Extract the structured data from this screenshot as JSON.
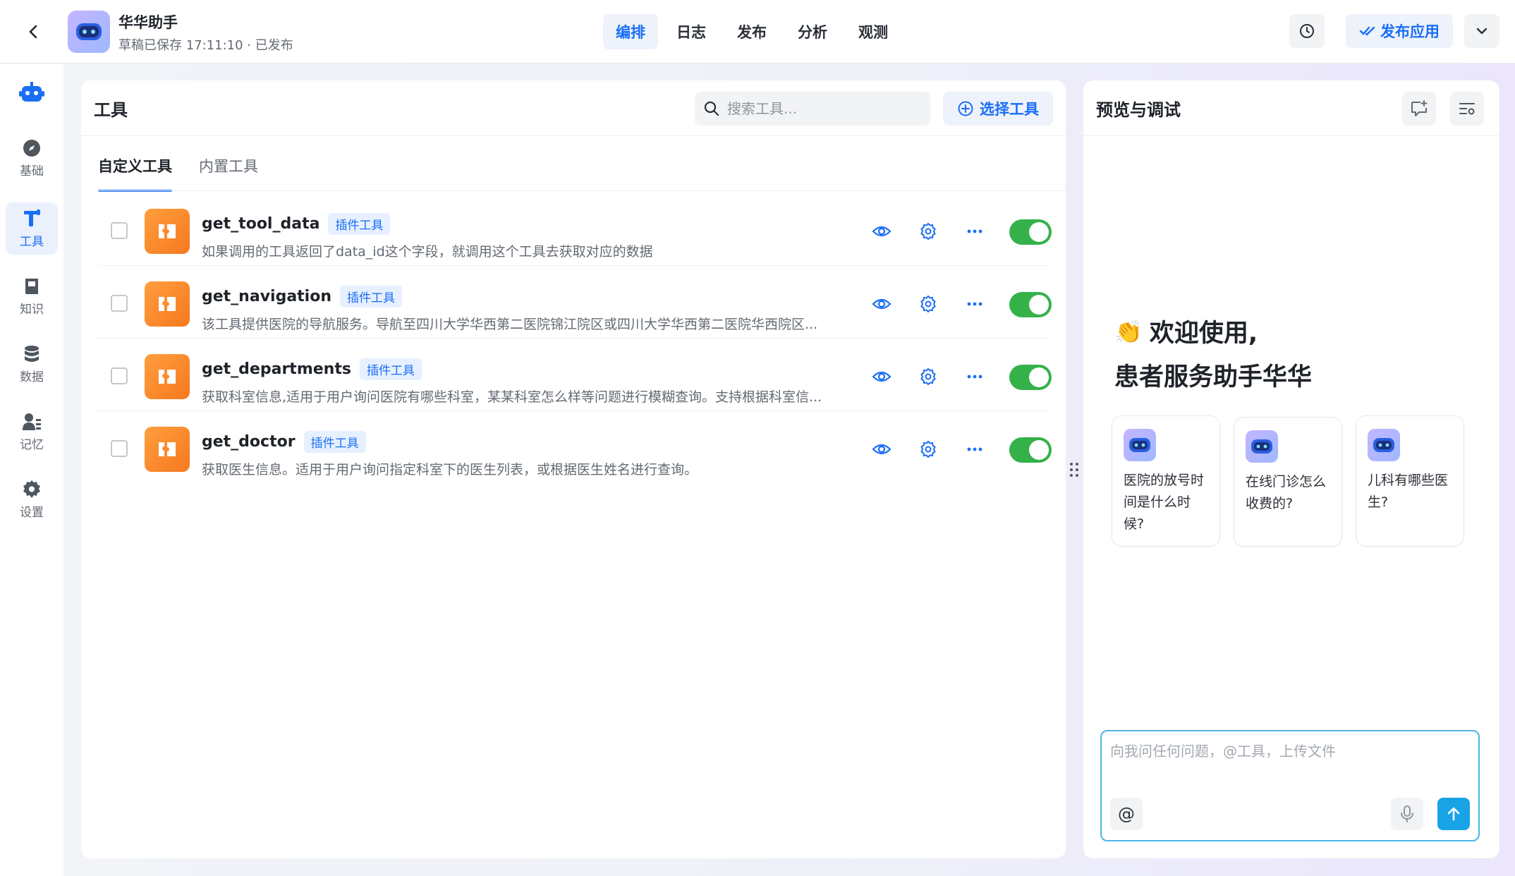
{
  "header": {
    "app_name": "华华助手",
    "status": "草稿已保存 17:11:10 · 已发布",
    "tabs": [
      {
        "label": "编排",
        "active": true
      },
      {
        "label": "日志",
        "active": false
      },
      {
        "label": "发布",
        "active": false
      },
      {
        "label": "分析",
        "active": false
      },
      {
        "label": "观测",
        "active": false
      }
    ],
    "publish_label": "发布应用",
    "accent_color": "#1a6ef5"
  },
  "rail": {
    "items": [
      {
        "label": "基础",
        "icon": "compass-icon",
        "active": false
      },
      {
        "label": "工具",
        "icon": "tool-icon",
        "active": true
      },
      {
        "label": "知识",
        "icon": "book-icon",
        "active": false
      },
      {
        "label": "数据",
        "icon": "database-icon",
        "active": false
      },
      {
        "label": "记忆",
        "icon": "user-memory-icon",
        "active": false
      },
      {
        "label": "设置",
        "icon": "gear-icon",
        "active": false
      }
    ]
  },
  "tools": {
    "title": "工具",
    "search_placeholder": "搜索工具...",
    "select_label": "选择工具",
    "sub_tabs": [
      {
        "label": "自定义工具",
        "active": true
      },
      {
        "label": "内置工具",
        "active": false
      }
    ],
    "items": [
      {
        "name": "get_tool_data",
        "tag": "插件工具",
        "desc": "如果调用的工具返回了data_id这个字段，就调用这个工具去获取对应的数据",
        "enabled": true
      },
      {
        "name": "get_navigation",
        "tag": "插件工具",
        "desc": "该工具提供医院的导航服务。导航至四川大学华西第二医院锦江院区或四川大学华西第二医院华西院区...",
        "enabled": true
      },
      {
        "name": "get_departments",
        "tag": "插件工具",
        "desc": "获取科室信息,适用于用户询问医院有哪些科室，某某科室怎么样等问题进行模糊查询。支持根据科室信...",
        "enabled": true
      },
      {
        "name": "get_doctor",
        "tag": "插件工具",
        "desc": "获取医生信息。适用于用户询问指定科室下的医生列表，或根据医生姓名进行查询。",
        "enabled": true
      }
    ],
    "toggle_on_color": "#34b249"
  },
  "preview": {
    "title": "预览与调试",
    "welcome_line1": "欢迎使用,",
    "welcome_emoji": "👏",
    "welcome_line2": "患者服务助手华华",
    "suggestions": [
      "医院的放号时间是什么时候?",
      "在线门诊怎么收费的?",
      "儿科有哪些医生?"
    ],
    "input_placeholder": "向我问任何问题，@工具，上传文件",
    "at_label": "@"
  }
}
